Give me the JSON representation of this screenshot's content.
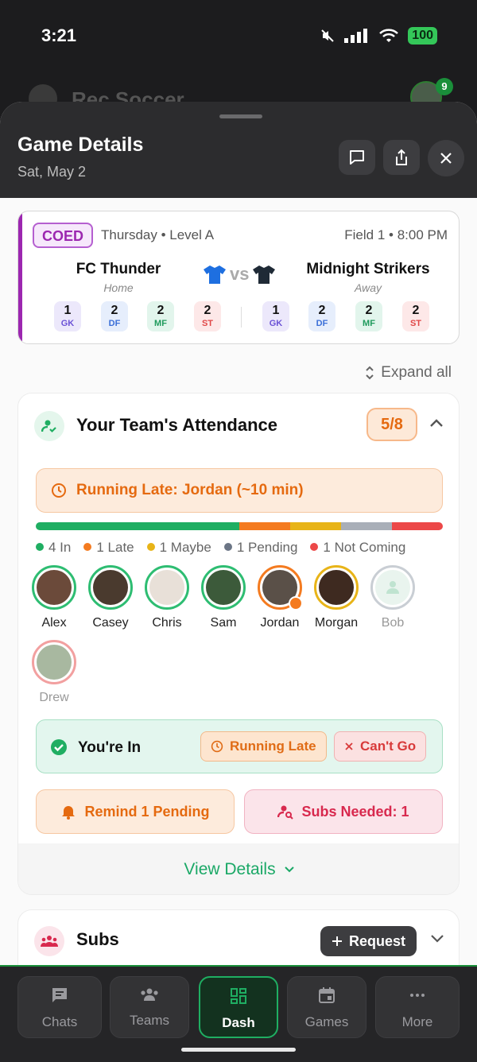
{
  "status_bar": {
    "time": "3:21",
    "battery": "100"
  },
  "background_app": {
    "title": "Rec Soccer",
    "notification_count": "9"
  },
  "sheet": {
    "title": "Game Details",
    "date": "Sat, May 2"
  },
  "match": {
    "tag": "COED",
    "day_level": "Thursday • Level A",
    "field_time": "Field 1 • 8:00 PM",
    "vs": "vs",
    "home": {
      "name": "FC Thunder",
      "side": "Home",
      "jersey_color": "#1e6fe0",
      "positions": [
        {
          "n": "1",
          "l": "GK"
        },
        {
          "n": "2",
          "l": "DF"
        },
        {
          "n": "2",
          "l": "MF"
        },
        {
          "n": "2",
          "l": "ST"
        }
      ]
    },
    "away": {
      "name": "Midnight Strikers",
      "side": "Away",
      "jersey_color": "#1f2a36",
      "positions": [
        {
          "n": "1",
          "l": "GK"
        },
        {
          "n": "2",
          "l": "DF"
        },
        {
          "n": "2",
          "l": "MF"
        },
        {
          "n": "2",
          "l": "ST"
        }
      ]
    }
  },
  "expand_all": "Expand all",
  "attendance": {
    "title": "Your Team's Attendance",
    "count": "5/8",
    "late_banner": "Running Late: Jordan (~10 min)",
    "progress": [
      {
        "status": "in",
        "count": 4,
        "color": "#1fae62"
      },
      {
        "status": "late",
        "count": 1,
        "color": "#f47b20"
      },
      {
        "status": "maybe",
        "count": 1,
        "color": "#e8b418"
      },
      {
        "status": "pending",
        "count": 1,
        "color": "#a9afb8"
      },
      {
        "status": "not_coming",
        "count": 1,
        "color": "#ec4848"
      }
    ],
    "legend": [
      {
        "label": "4 In",
        "color": "#1fae62"
      },
      {
        "label": "1 Late",
        "color": "#f47b20"
      },
      {
        "label": "1 Maybe",
        "color": "#e8b418"
      },
      {
        "label": "1 Pending",
        "color": "#6b7585"
      },
      {
        "label": "1 Not Coming",
        "color": "#ec4848"
      }
    ],
    "players": [
      {
        "name": "Alex",
        "status": "in"
      },
      {
        "name": "Casey",
        "status": "in"
      },
      {
        "name": "Chris",
        "status": "in"
      },
      {
        "name": "Sam",
        "status": "in"
      },
      {
        "name": "Jordan",
        "status": "late"
      },
      {
        "name": "Morgan",
        "status": "maybe"
      },
      {
        "name": "Bob",
        "status": "pending"
      },
      {
        "name": "Drew",
        "status": "not_coming"
      }
    ],
    "you_in_label": "You're In",
    "running_late_btn": "Running Late",
    "cant_go_btn": "Can't Go",
    "remind_btn": "Remind 1 Pending",
    "subs_needed_btn": "Subs Needed: 1",
    "view_details": "View Details"
  },
  "subs": {
    "title": "Subs",
    "request_btn": "Request"
  },
  "tabs": [
    {
      "label": "Chats",
      "icon": "chat-icon"
    },
    {
      "label": "Teams",
      "icon": "teams-icon"
    },
    {
      "label": "Dash",
      "icon": "dashboard-icon",
      "active": true
    },
    {
      "label": "Games",
      "icon": "calendar-icon"
    },
    {
      "label": "More",
      "icon": "more-icon"
    }
  ]
}
